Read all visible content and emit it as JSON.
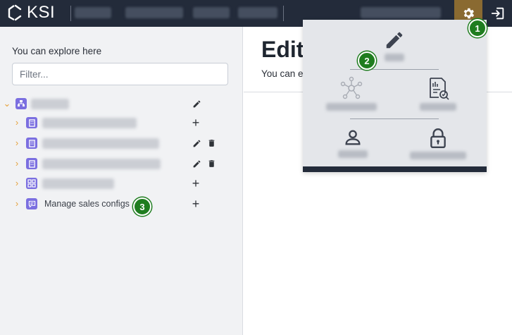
{
  "topbar": {
    "logo_text": "KSI",
    "icons": {
      "settings": "gear-icon",
      "logout": "logout-icon"
    }
  },
  "sidebar": {
    "explore_label": "You can explore here",
    "filter_placeholder": "Filter...",
    "items": [
      {
        "label": "",
        "icon": "org-icon",
        "actions": [
          "edit"
        ]
      },
      {
        "label": "",
        "icon": "building-icon",
        "actions": [
          "add"
        ]
      },
      {
        "label": "",
        "icon": "building-icon",
        "actions": [
          "edit",
          "delete"
        ]
      },
      {
        "label": "",
        "icon": "building-icon",
        "actions": [
          "edit",
          "delete"
        ]
      },
      {
        "label": "",
        "icon": "grid-icon",
        "actions": [
          "add"
        ]
      },
      {
        "label": "Manage sales configs",
        "icon": "chat-icon",
        "actions": [
          "add"
        ]
      }
    ]
  },
  "main": {
    "title": "Edit",
    "subtitle": "You can e"
  },
  "settings_menu": {
    "items": [
      {
        "icon": "pencil-icon",
        "label": ""
      },
      {
        "icon": "network-icon",
        "label": ""
      },
      {
        "icon": "report-icon",
        "label": ""
      },
      {
        "icon": "user-icon",
        "label": ""
      },
      {
        "icon": "lock-icon",
        "label": ""
      }
    ]
  },
  "badges": [
    "1",
    "2",
    "3"
  ],
  "colors": {
    "topbar": "#232b3a",
    "gear_active": "#8a6a31",
    "node_icon": "#7b6fe0",
    "chevron": "#e6a23c",
    "badge": "#1f7d1f"
  }
}
